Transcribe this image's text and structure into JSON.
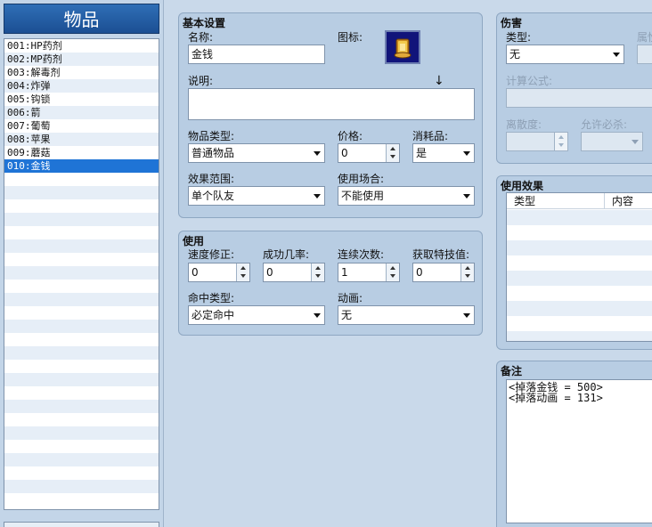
{
  "left": {
    "title": "物品",
    "items": [
      {
        "label": "001:HP药剂"
      },
      {
        "label": "002:MP药剂"
      },
      {
        "label": "003:解毒剂"
      },
      {
        "label": "004:炸弹"
      },
      {
        "label": "005:钩锁"
      },
      {
        "label": "006:箭"
      },
      {
        "label": "007:葡萄"
      },
      {
        "label": "008:苹果"
      },
      {
        "label": "009:蘑菇"
      },
      {
        "label": "010:金钱",
        "selected": true
      }
    ]
  },
  "basic": {
    "title": "基本设置",
    "name_label": "名称:",
    "name_value": "金钱",
    "icon_label": "图标:",
    "icon_name": "gold-coin-stack-icon",
    "desc_label": "说明:",
    "desc_value": "",
    "desc_arrow": "↓",
    "type_label": "物品类型:",
    "type_value": "普通物品",
    "price_label": "价格:",
    "price_value": "0",
    "consumable_label": "消耗品:",
    "consumable_value": "是",
    "scope_label": "效果范围:",
    "scope_value": "单个队友",
    "occasion_label": "使用场合:",
    "occasion_value": "不能使用"
  },
  "usage": {
    "title": "使用",
    "speed_label": "速度修正:",
    "speed_value": "0",
    "success_label": "成功几率:",
    "success_value": "0",
    "repeats_label": "连续次数:",
    "repeats_value": "1",
    "tp_label": "获取特技值:",
    "tp_value": "0",
    "hit_type_label": "命中类型:",
    "hit_type_value": "必定命中",
    "animation_label": "动画:",
    "animation_value": "无"
  },
  "damage": {
    "title": "伤害",
    "type_label": "类型:",
    "type_value": "无",
    "element_label": "属性",
    "formula_label": "计算公式:",
    "variance_label": "离散度:",
    "critical_label": "允许必杀:"
  },
  "effects": {
    "title": "使用效果",
    "col_type": "类型",
    "col_content": "内容"
  },
  "note": {
    "title": "备注",
    "text": "<掉落金钱 = 500>\n<掉落动画 = 131>"
  }
}
